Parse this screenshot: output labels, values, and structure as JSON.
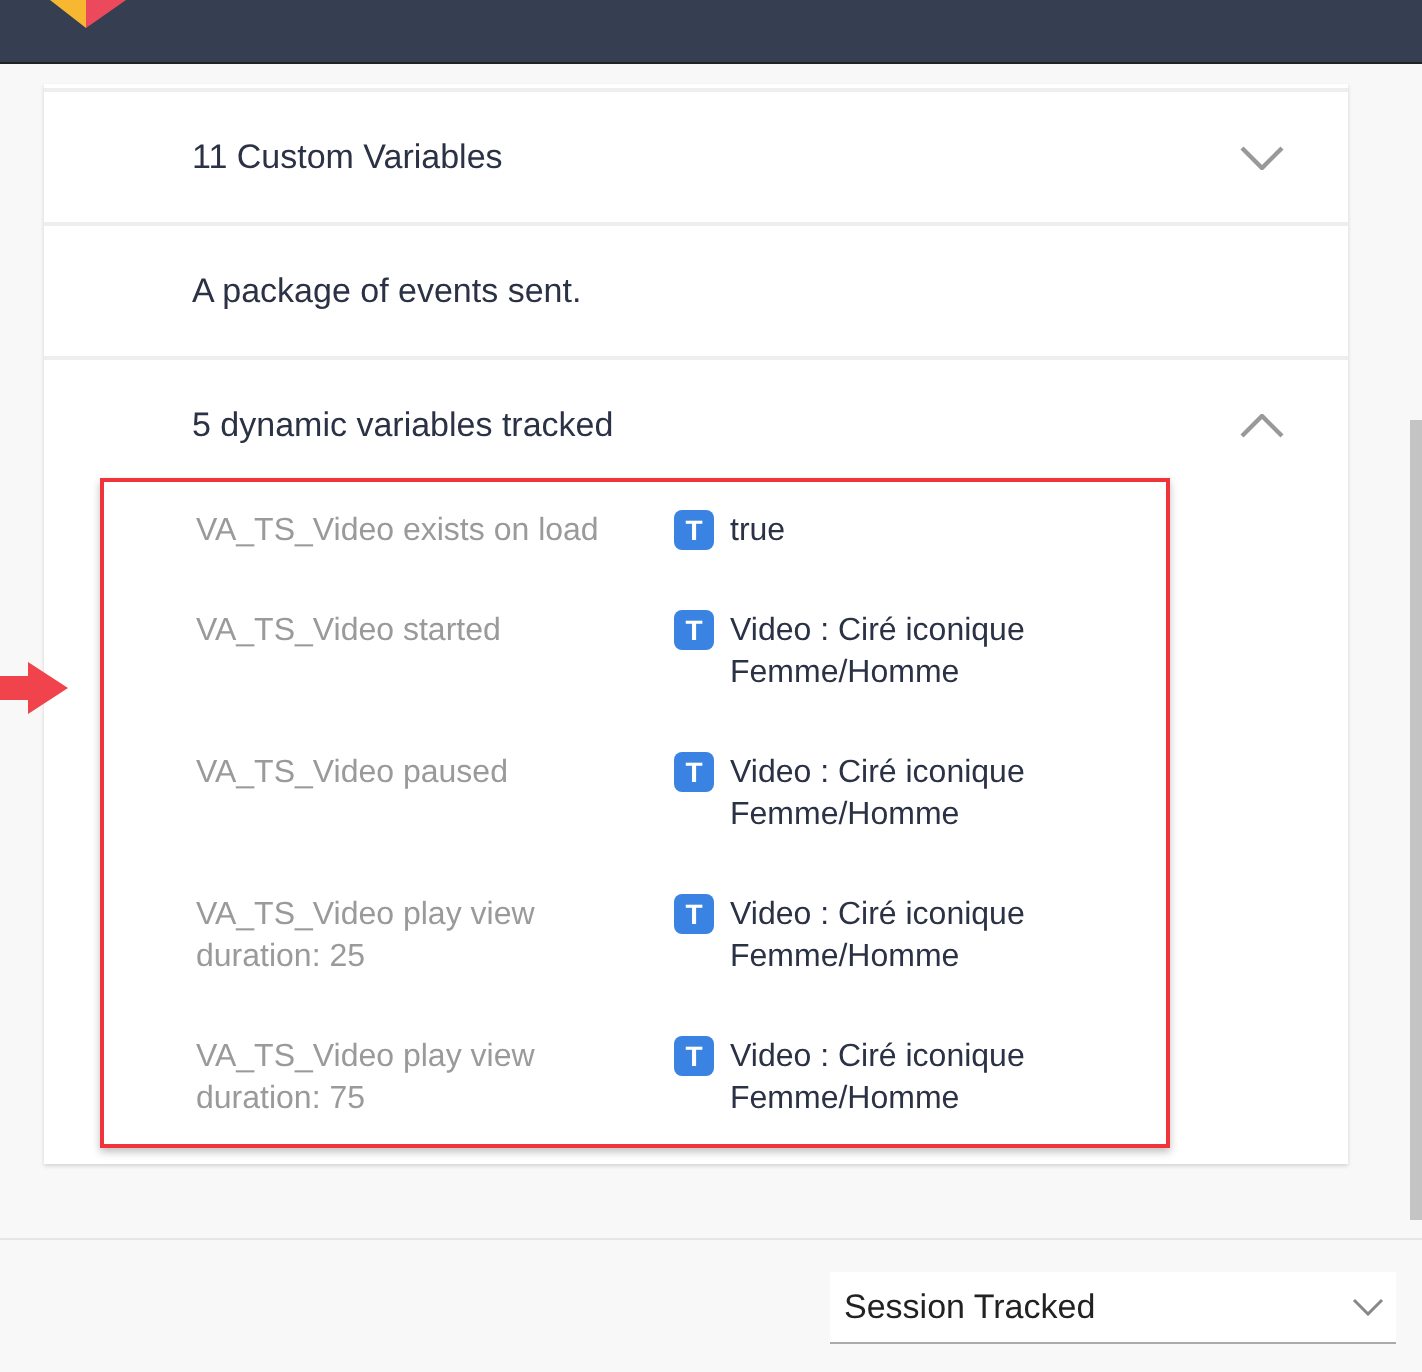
{
  "sections": [
    {
      "kind": "collapsible",
      "title": "11 Custom Variables",
      "expanded": false
    },
    {
      "kind": "text",
      "title": "A package of events sent."
    },
    {
      "kind": "collapsible",
      "title": "5 dynamic variables tracked",
      "expanded": true,
      "variables": [
        {
          "name": "VA_TS_Video exists on load",
          "type": "T",
          "value": "true"
        },
        {
          "name": "VA_TS_Video started",
          "type": "T",
          "value": "Video : Ciré iconique Femme/Homme"
        },
        {
          "name": "VA_TS_Video paused",
          "type": "T",
          "value": "Video : Ciré iconique Femme/Homme"
        },
        {
          "name": "VA_TS_Video play view duration: 25",
          "type": "T",
          "value": "Video : Ciré iconique Femme/Homme"
        },
        {
          "name": "VA_TS_Video play view duration: 75",
          "type": "T",
          "value": "Video : Ciré iconique Femme/Homme"
        }
      ]
    }
  ],
  "dropdown": {
    "value": "Session Tracked"
  }
}
